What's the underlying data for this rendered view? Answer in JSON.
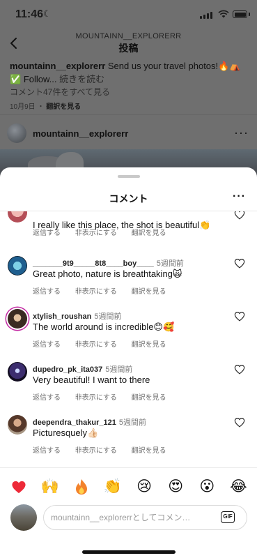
{
  "status_bar": {
    "time": "11:46",
    "moon": "☾"
  },
  "post_header": {
    "username": "MOUNTAINN__EXPLORERR",
    "title": "投稿"
  },
  "caption": {
    "username": "mountainn__explorerr",
    "text": "Send us your travel photos!🔥⛺",
    "line2_emoji": "✅",
    "line2_text": "Follow...",
    "read_more": "続きを読む"
  },
  "view_all_comments": "コメント47件をすべて見る",
  "post_meta": {
    "date": "10月9日",
    "separator": "・",
    "translate": "翻訳を見る"
  },
  "post_author": {
    "username": "mountainn__explorerr"
  },
  "sheet": {
    "title": "コメント",
    "more": "···"
  },
  "comment_actions": {
    "reply": "返信する",
    "hide": "非表示にする",
    "translate": "翻訳を見る"
  },
  "comments": [
    {
      "username": "",
      "ago": "",
      "text": "I really like this place, the shot is beautiful👏"
    },
    {
      "username": "_______9t9_____8t8____boy____",
      "ago": "5週間前",
      "text": "Great photo, nature is breathtaking🙀"
    },
    {
      "username": "xtylish_roushan",
      "ago": "5週間前",
      "text": "The world around is incredible😊🥰"
    },
    {
      "username": "dupedro_pk_ita037",
      "ago": "5週間前",
      "text": "Very beautiful! I want to there"
    },
    {
      "username": "deependra_thakur_121",
      "ago": "5週間前",
      "text": "Picturesquely👍🏻"
    }
  ],
  "emoji_bar": [
    "❤️",
    "🙌",
    "🔥",
    "👏",
    "😢",
    "😍",
    "😮",
    "😂"
  ],
  "composer": {
    "placeholder": "mountainn__explorerrとしてコメン…",
    "gif_label": "GIF"
  },
  "colors": {
    "accent_ring": "#c32aa3",
    "heart_red": "#ed2a38",
    "fire_orange": "#f3822b"
  }
}
